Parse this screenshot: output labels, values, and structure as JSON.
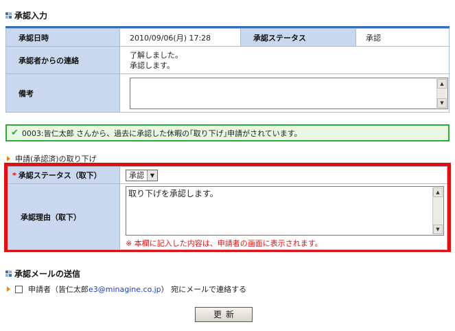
{
  "approval_input": {
    "title": "承認入力",
    "date_label": "承認日時",
    "date_value": "2010/09/06(月) 17:28",
    "status_label": "承認ステータス",
    "status_value": "承認",
    "contact_label": "承認者からの連絡",
    "contact_line1": "了解しました。",
    "contact_line2": "承認します。",
    "remarks_label": "備考",
    "remarks_value": ""
  },
  "notice": {
    "text": "0003:皆仁太郎 さんから、過去に承認した休暇の｢取り下げ｣申請がされています。"
  },
  "withdrawal": {
    "section_label": "申請(承認済)の取り下げ",
    "required_mark": "*",
    "status_label": "承認ステータス（取下）",
    "status_selected": "承認",
    "reason_label": "承認理由（取下）",
    "reason_value": "取り下げを承認します。",
    "reason_note": "※ 本欄に記入した内容は、申請者の画面に表示されます。"
  },
  "mail": {
    "title": "承認メールの送信",
    "prefix": "申請者（皆仁太郎 ",
    "email": "e3@minagine.co.jp",
    "suffix": "） 宛にメールで連絡する"
  },
  "update_button": "更新",
  "colors": {
    "header_bg": "#c9d8ee",
    "accent_blue": "#3a6fb5",
    "notice_green": "#33a833",
    "highlight_red": "#dd1111",
    "note_red": "#dd1111"
  }
}
